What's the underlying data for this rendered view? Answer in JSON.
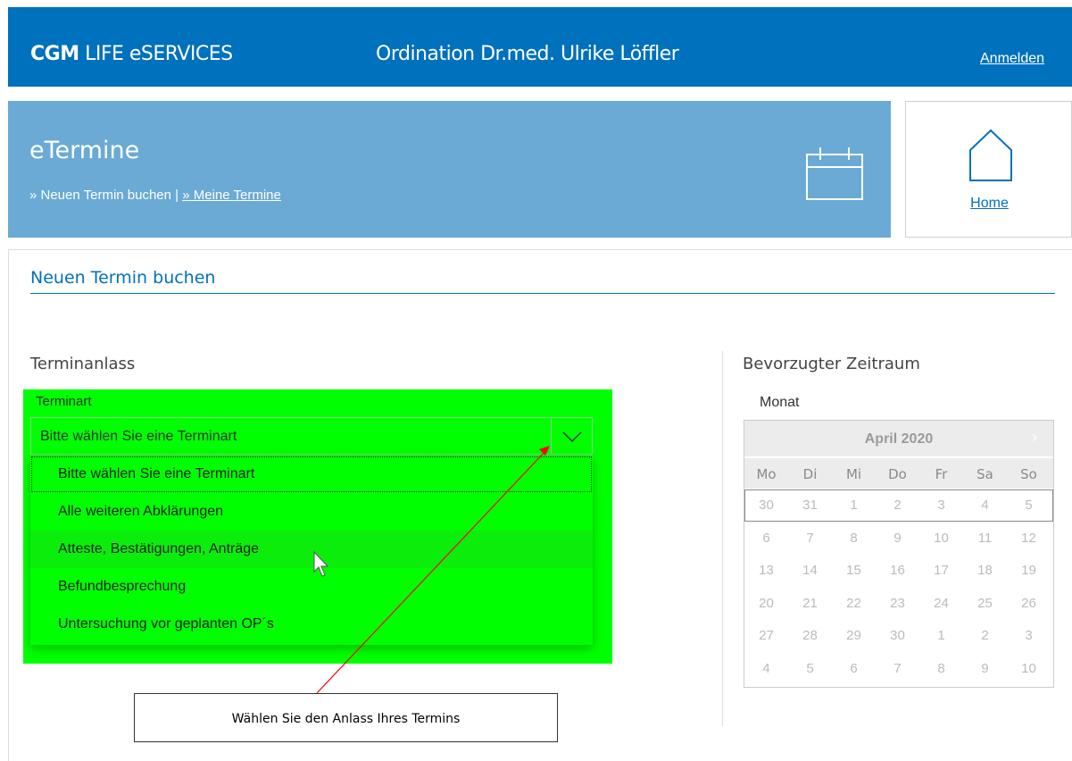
{
  "header": {
    "brand_bold": "CGM",
    "brand_rest": " LIFE eSERVICES",
    "practice": "Ordination Dr.med. Ulrike Löffler",
    "login": "Anmelden"
  },
  "banner": {
    "title": "eTermine",
    "crumb_prefix": "» Neuen Termin buchen | ",
    "crumb_link": "» Meine Termine",
    "home_label": "Home"
  },
  "section": {
    "title": "Neuen Termin buchen",
    "left_title": "Terminanlass",
    "right_title": "Bevorzugter Zeitraum"
  },
  "terminart": {
    "label": "Terminart",
    "selected": "Bitte wählen Sie eine Terminart",
    "options": [
      "Bitte wählen Sie eine Terminart",
      "Alle weiteren Abklärungen",
      "Atteste, Bestätigungen, Anträge",
      "Befundbesprechung",
      "Untersuchung vor geplanten OP´s"
    ]
  },
  "tooltip": "Wählen Sie den Anlass Ihres Termins",
  "calendar": {
    "label": "Monat",
    "title": "April 2020",
    "next": "›",
    "weekdays": [
      "Mo",
      "Di",
      "Mi",
      "Do",
      "Fr",
      "Sa",
      "So"
    ],
    "weeks": [
      [
        "30",
        "31",
        "1",
        "2",
        "3",
        "4",
        "5"
      ],
      [
        "6",
        "7",
        "8",
        "9",
        "10",
        "11",
        "12"
      ],
      [
        "13",
        "14",
        "15",
        "16",
        "17",
        "18",
        "19"
      ],
      [
        "20",
        "21",
        "22",
        "23",
        "24",
        "25",
        "26"
      ],
      [
        "27",
        "28",
        "29",
        "30",
        "1",
        "2",
        "3"
      ],
      [
        "4",
        "5",
        "6",
        "7",
        "8",
        "9",
        "10"
      ]
    ]
  },
  "colors": {
    "brand_blue": "#0071bc",
    "banner_blue": "#6aaad5",
    "highlight_green": "#00ff00",
    "annotation_red": "#ff0000"
  }
}
